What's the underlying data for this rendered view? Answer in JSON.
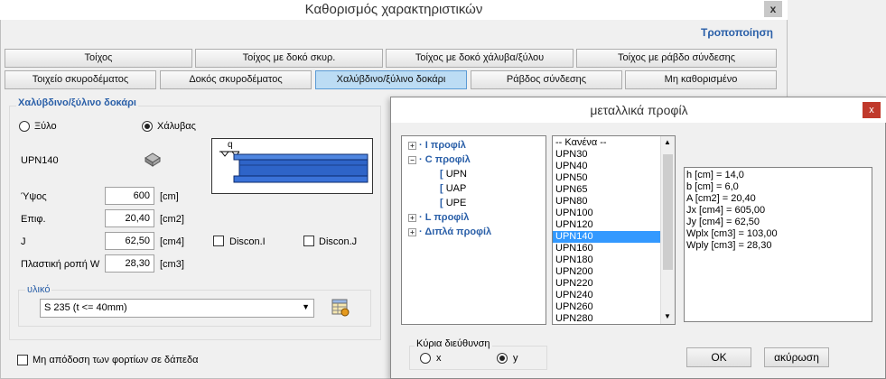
{
  "window": {
    "title": "Καθορισμός χαρακτηριστικών",
    "close": "x",
    "mode": "Τροποποίηση"
  },
  "tabs_row1": [
    "Τοίχος",
    "Τοίχος με δοκό σκυρ.",
    "Τοίχος με δοκό χάλυβα/ξύλου",
    "Τοίχος με ράβδο σύνδεσης"
  ],
  "tabs_row2": [
    "Τοιχείο σκυροδέματος",
    "Δοκός σκυροδέματος",
    "Χαλύβδινο/ξύλινο δοκάρι",
    "Ράβδος σύνδεσης",
    "Μη καθορισμένο"
  ],
  "selected_tab": "Χαλύβδινο/ξύλινο δοκάρι",
  "section": {
    "title": "Χαλύβδινο/ξύλινο δοκάρι",
    "material_wood": "Ξύλο",
    "material_steel": "Χάλυβας",
    "material_selected": "Χάλυβας",
    "profile_name": "UPN140",
    "height": {
      "label": "Ύψος",
      "value": "600",
      "unit": "[cm]"
    },
    "area": {
      "label": "Επιφ.",
      "value": "20,40",
      "unit": "[cm2]"
    },
    "inertia": {
      "label": "J",
      "value": "62,50",
      "unit": "[cm4]"
    },
    "plastic": {
      "label": "Πλαστική ροπή W",
      "value": "28,30",
      "unit": "[cm3]"
    },
    "discon_i": "Discon.I",
    "discon_j": "Discon.J",
    "load_symbol": "q",
    "material_group": "υλικό",
    "material_value": "S 235 (t <= 40mm)",
    "no_loads": "Μη απόδοση των φορτίων σε δάπεδα"
  },
  "dialog": {
    "title": "μεταλλικά προφίλ",
    "close": "x",
    "tree": [
      {
        "label": "I προφίλ",
        "expander": "+",
        "bold": true
      },
      {
        "label": "C προφίλ",
        "expander": "−",
        "bold": true
      },
      {
        "label": "UPN",
        "child": true
      },
      {
        "label": "UAP",
        "child": true
      },
      {
        "label": "UPE",
        "child": true
      },
      {
        "label": "L προφίλ",
        "expander": "+",
        "bold": true
      },
      {
        "label": "Διπλά προφίλ",
        "expander": "+",
        "bold": true
      }
    ],
    "list": [
      "-- Κανένα --",
      "UPN30",
      "UPN40",
      "UPN50",
      "UPN65",
      "UPN80",
      "UPN100",
      "UPN120",
      "UPN140",
      "UPN160",
      "UPN180",
      "UPN200",
      "UPN220",
      "UPN240",
      "UPN260",
      "UPN280"
    ],
    "list_selected": "UPN140",
    "properties": [
      "h [cm] = 14,0",
      "b [cm] = 6,0",
      "A [cm2] = 20,40",
      "Jx [cm4] = 605,00",
      "Jy [cm4] = 62,50",
      "Wplx [cm3] = 103,00",
      "Wply [cm3] = 28,30"
    ],
    "axis_group": "Κύρια διεύθυνση",
    "axis_x": "x",
    "axis_y": "y",
    "axis_selected": "y",
    "ok": "OK",
    "cancel": "ακύρωση"
  },
  "colors": {
    "accent": "#2a5fa8",
    "selected_tab": "#bcdcf4",
    "list_selection": "#3399ff",
    "beam_blue": "#2e64c8",
    "dialog_close": "#c0392b"
  }
}
